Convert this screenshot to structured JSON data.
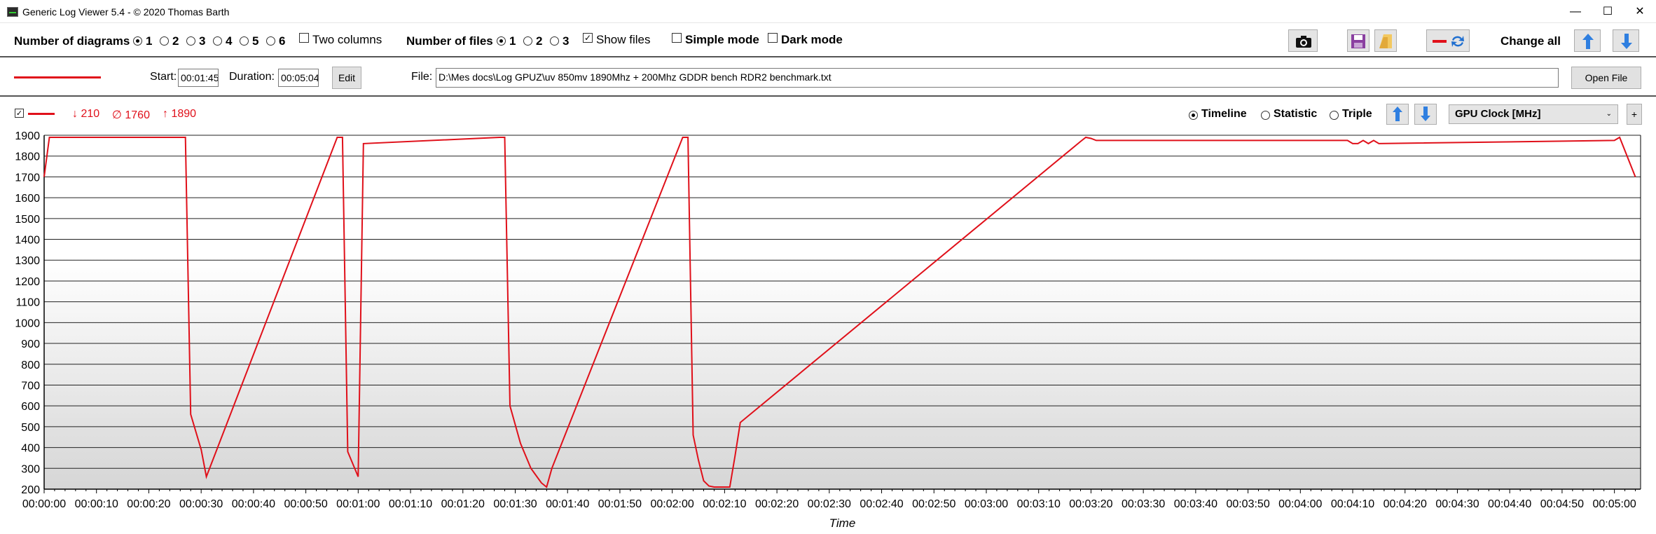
{
  "window": {
    "title": "Generic Log Viewer 5.4 - © 2020 Thomas Barth",
    "minimize": "—",
    "maximize": "☐",
    "close": "✕"
  },
  "toolbar": {
    "diagrams_label": "Number of diagrams",
    "diagram_options": [
      "1",
      "2",
      "3",
      "4",
      "5",
      "6"
    ],
    "diagrams_selected": "1",
    "two_columns_label": "Two columns",
    "two_columns_checked": false,
    "files_label": "Number of files",
    "file_options": [
      "1",
      "2",
      "3"
    ],
    "files_selected": "1",
    "show_files_label": "Show files",
    "show_files_checked": true,
    "simple_mode_label": "Simple mode",
    "dark_mode_label": "Dark mode",
    "change_all_label": "Change all",
    "icons": [
      "camera-icon",
      "save-icon",
      "folder-icon",
      "line-color-icon",
      "arrow-up-icon",
      "arrow-down-icon"
    ]
  },
  "filebar": {
    "start_label": "Start:",
    "start_value": "00:01:45",
    "duration_label": "Duration:",
    "duration_value": "00:05:04",
    "edit_label": "Edit",
    "file_label": "File:",
    "file_path": "D:\\Mes docs\\Log GPUZ\\uv 850mv 1890Mhz + 200Mhz GDDR bench RDR2 benchmark.txt",
    "open_file_label": "Open File",
    "line_color": "#e0101a"
  },
  "chartbar": {
    "series_visible": true,
    "min_label": "↓ 210",
    "avg_label": "∅ 1760",
    "max_label": "↑ 1890",
    "modes": [
      "Timeline",
      "Statistic",
      "Triple"
    ],
    "mode_selected": "Timeline",
    "channel": "GPU Clock [MHz]",
    "add_label": "+"
  },
  "chart_data": {
    "type": "line",
    "xlabel": "Time",
    "ylabel": "",
    "ylim": [
      200,
      1900
    ],
    "xlim": [
      0,
      305
    ],
    "y_ticks": [
      1900,
      1800,
      1700,
      1600,
      1500,
      1400,
      1300,
      1200,
      1100,
      1000,
      900,
      800,
      700,
      600,
      500,
      400,
      300,
      200
    ],
    "x_ticks": [
      "00:00:00",
      "00:00:10",
      "00:00:20",
      "00:00:30",
      "00:00:40",
      "00:00:50",
      "00:01:00",
      "00:01:10",
      "00:01:20",
      "00:01:30",
      "00:01:40",
      "00:01:50",
      "00:02:00",
      "00:02:10",
      "00:02:20",
      "00:02:30",
      "00:02:40",
      "00:02:50",
      "00:03:00",
      "00:03:10",
      "00:03:20",
      "00:03:30",
      "00:03:40",
      "00:03:50",
      "00:04:00",
      "00:04:10",
      "00:04:20",
      "00:04:30",
      "00:04:40",
      "00:04:50",
      "00:05:00"
    ],
    "grid": true,
    "series": [
      {
        "color": "#e0101a",
        "x": [
          0,
          1,
          26,
          27,
          28,
          30,
          31,
          56,
          57,
          58,
          60,
          61,
          87,
          88,
          89,
          91,
          93,
          95,
          96,
          97,
          122,
          123,
          124,
          125,
          126,
          127,
          128,
          129,
          130,
          131,
          132,
          133,
          198,
          199,
          200,
          201,
          249,
          250,
          251,
          252,
          253,
          254,
          255,
          300,
          301,
          304
        ],
        "y": [
          1700,
          1890,
          1890,
          1890,
          560,
          390,
          260,
          1890,
          1890,
          380,
          260,
          1860,
          1890,
          1890,
          600,
          420,
          300,
          230,
          210,
          300,
          1890,
          1890,
          460,
          340,
          240,
          215,
          210,
          210,
          210,
          210,
          360,
          520,
          1870,
          1890,
          1885,
          1875,
          1875,
          1860,
          1860,
          1875,
          1860,
          1875,
          1860,
          1875,
          1890,
          1700
        ]
      }
    ]
  }
}
